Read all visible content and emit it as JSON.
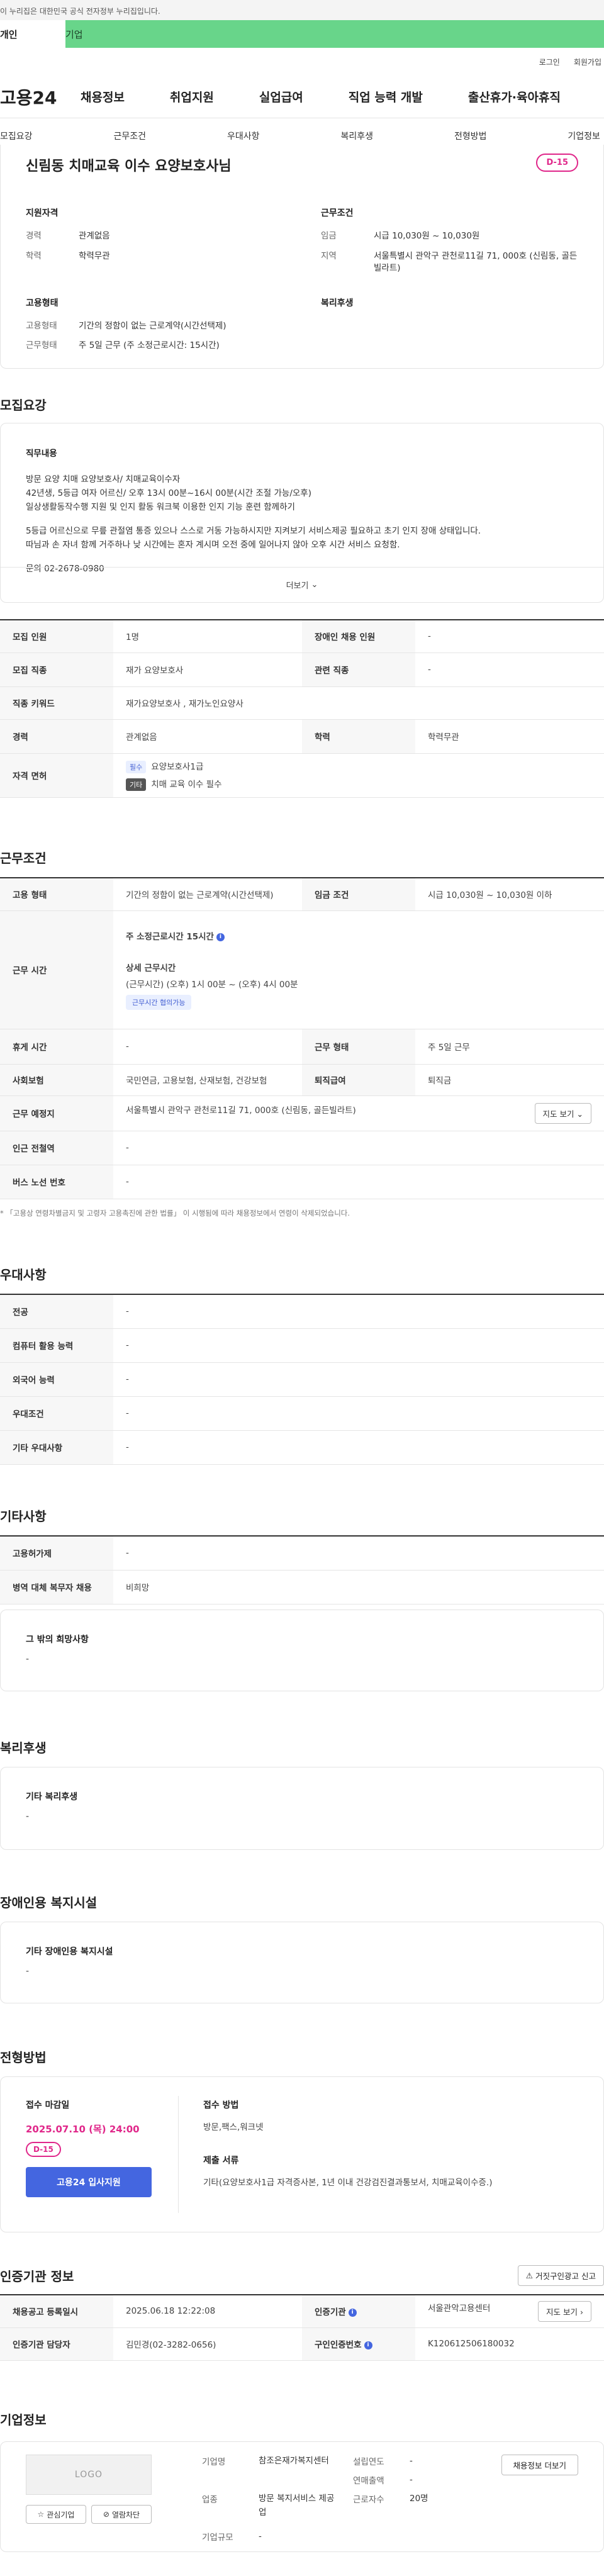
{
  "gov_banner": "이 누리집은 대한민국 공식 전자정부 누리집입니다.",
  "tabs": {
    "personal": "개인",
    "company": "기업"
  },
  "util": {
    "login": "로그인",
    "signup": "회원가입"
  },
  "gnb": {
    "logo": "고용24",
    "items": [
      "채용정보",
      "취업지원",
      "실업급여",
      "직업 능력 개발",
      "출산휴가·육아휴직"
    ]
  },
  "anchors": [
    "모집요강",
    "근무조건",
    "우대사항",
    "복리후생",
    "전형방법",
    "기업정보"
  ],
  "summary": {
    "title": "신림동 치매교육 이수 요양보호사님",
    "dday": "D-15",
    "qual_title": "지원자격",
    "qual": [
      {
        "k": "경력",
        "v": "관계없음"
      },
      {
        "k": "학력",
        "v": "학력무관"
      }
    ],
    "work_title": "근무조건",
    "work": [
      {
        "k": "임금",
        "v": "시급 10,030원 ~ 10,030원"
      },
      {
        "k": "지역",
        "v": "서울특별시 관악구 관천로11길 71, 000호 (신림동, 골든빌라트)"
      }
    ],
    "emp_title": "고용형태",
    "emp": [
      {
        "k": "고용형태",
        "v": "기간의 정함이 없는 근로계약(시간선택제)"
      },
      {
        "k": "근무형태",
        "v": "주 5일 근무 (주 소정근로시간: 15시간)"
      }
    ],
    "welfare_title": "복리후생"
  },
  "recruit": {
    "section_title": "모집요강",
    "duty_title": "직무내용",
    "lines": [
      "방문 요양  치매 요양보호사/ 치매교육이수자",
      "42년생, 5등급 여자 어르신/ 오후 13시 00분~16시 00분(시간 조절 가능/오후)",
      "일상생활동작수행 지원 및 인지 활동 워크북 이용한 인지 기능 훈련 함께하기",
      "",
      "5등급 어르신으로 무릎 관절염 통증 있으나 스스로 거동 가능하시지만 지켜보기 서비스제공 필요하고 초기 인지 장애 상태입니다.",
      "따님과 손 자녀 함께 거주하나 낮 시간에는 혼자 계시며 오전 중에 일어나지 않아 오후 시간 서비스 요청함.",
      "",
      "문의 02-2678-0980"
    ],
    "more": "더보기",
    "table": {
      "headcount_label": "모집 인원",
      "headcount": "1명",
      "disabled_label": "장애인 채용 인원",
      "disabled": "-",
      "job_label": "모집 직종",
      "job": "재가 요양보호사",
      "related_label": "관련 직종",
      "related": "-",
      "keyword_label": "직종 키워드",
      "keyword": "재가요양보호사 , 재가노인요양사",
      "career_label": "경력",
      "career": "관계없음",
      "edu_label": "학력",
      "edu": "학력무관",
      "license_label": "자격 면허",
      "license_req_badge": "필수",
      "license_req": "요양보호사1급",
      "license_pref_badge": "기타",
      "license_pref": "치매 교육 이수 필수"
    }
  },
  "workcond": {
    "section_title": "근무조건",
    "emp_label": "고용 형태",
    "emp": "기간의 정함이 없는 근로계약(시간선택제)",
    "wage_label": "임금 조건",
    "wage": "시급 10,030원 ~ 10,030원 이하",
    "hours_label": "근무 시간",
    "weekly_hours": "주 소정근로시간  15시간",
    "detail_title": "상세 근무시간",
    "detail": "(근무시간) (오후) 1시 00분 ~ (오후) 4시 00분",
    "flex_badge": "근무시간 협의가능",
    "rest_label": "휴게 시간",
    "rest": "-",
    "workform_label": "근무 형태",
    "workform": "주 5일 근무",
    "insurance_label": "사회보험",
    "insurance": "국민연금, 고용보험, 산재보험, 건강보험",
    "severance_label": "퇴직급여",
    "severance": "퇴직금",
    "place_label": "근무 예정지",
    "place": "서울특별시 관악구 관천로11길 71, 000호 (신림동, 골든빌라트)",
    "map_btn": "지도 보기",
    "subway_label": "인근 전철역",
    "subway": "-",
    "bus_label": "버스 노선 번호",
    "bus": "-",
    "note": "* 「고용상 연령차별금지 및 고령자 고용촉진에 관한 법률」 이 시행됨에 따라 채용정보에서 연령이 삭제되었습니다."
  },
  "pref": {
    "section_title": "우대사항",
    "rows": [
      {
        "k": "전공",
        "v": "-"
      },
      {
        "k": "컴퓨터 활용 능력",
        "v": "-"
      },
      {
        "k": "외국어 능력",
        "v": "-"
      },
      {
        "k": "우대조건",
        "v": "-"
      },
      {
        "k": "기타 우대사항",
        "v": "-"
      }
    ]
  },
  "etc": {
    "section_title": "기타사항",
    "rows": [
      {
        "k": "고용허가제",
        "v": "-"
      },
      {
        "k": "병역 대체 복무자 채용",
        "v": "비희망"
      }
    ],
    "other_title": "그 밖의 희망사항",
    "other": "-"
  },
  "welfare": {
    "section_title": "복리후생",
    "card_title": "기타 복리후생",
    "value": "-"
  },
  "disabled_fac": {
    "section_title": "장애인용 복지시설",
    "card_title": "기타 장애인용 복지시설",
    "value": "-"
  },
  "process": {
    "section_title": "전형방법",
    "deadline_label": "접수 마감일",
    "deadline": "2025.07.10 (목) 24:00",
    "dday": "D-15",
    "apply": "고용24 입사지원",
    "method_title": "접수 방법",
    "method": "방문,팩스,워크넷",
    "docs_title": "제출 서류",
    "docs": "기타(요양보호사1급 자격증사본, 1년 이내 건강검진결과통보서, 치매교육이수증.)"
  },
  "cert": {
    "section_title": "인증기관 정보",
    "report_btn": "거짓구인광고 신고",
    "reg_date_label": "채용공고 등록일시",
    "reg_date": "2025.06.18 12:22:08",
    "org_label": "인증기관",
    "org": "서울관악고용센터",
    "map_btn": "지도 보기",
    "manager_label": "인증기관 담당자",
    "manager": "김민경(02-3282-0656)",
    "cert_no_label": "구인인증번호",
    "cert_no": "K120612506180032"
  },
  "company": {
    "section_title": "기업정보",
    "logo_text": "LOGO",
    "interest_btn": "관심기업",
    "block_btn": "열람차단",
    "name_label": "기업명",
    "name": "참조은재가복지센터",
    "est_label": "설립연도",
    "est": "-",
    "industry_label": "업종",
    "industry": "방문 복지서비스 제공업",
    "sales_label": "연매출액",
    "sales": "-",
    "employees_label": "근로자수",
    "employees": "20명",
    "size_label": "기업규모",
    "size": "-",
    "ws_btn": "채용정보 더보기"
  }
}
